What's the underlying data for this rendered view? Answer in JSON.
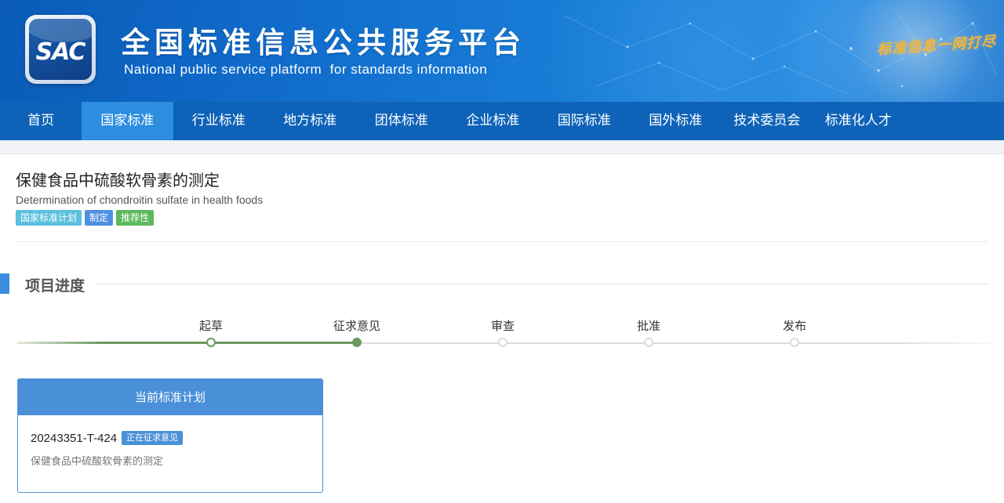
{
  "header": {
    "logo_text": "SAC",
    "title": "全国标准信息公共服务平台",
    "subtitle": "National public service platform  for standards information",
    "slogan": "标准信息一网打尽"
  },
  "nav": {
    "items": [
      {
        "label": "首页",
        "active": false
      },
      {
        "label": "国家标准",
        "active": true
      },
      {
        "label": "行业标准",
        "active": false
      },
      {
        "label": "地方标准",
        "active": false
      },
      {
        "label": "团体标准",
        "active": false
      },
      {
        "label": "企业标准",
        "active": false
      },
      {
        "label": "国际标准",
        "active": false
      },
      {
        "label": "国外标准",
        "active": false
      },
      {
        "label": "技术委员会",
        "active": false
      },
      {
        "label": "标准化人才",
        "active": false
      }
    ]
  },
  "standard": {
    "title_cn": "保健食品中硫酸软骨素的测定",
    "title_en": "Determination of chondroitin sulfate in health foods",
    "tags": [
      "国家标准计划",
      "制定",
      "推荐性"
    ]
  },
  "progress": {
    "heading": "项目进度",
    "steps": [
      {
        "label": "起草",
        "state": "done"
      },
      {
        "label": "征求意见",
        "state": "current"
      },
      {
        "label": "审查",
        "state": "pending"
      },
      {
        "label": "批准",
        "state": "pending"
      },
      {
        "label": "发布",
        "state": "pending"
      }
    ]
  },
  "current_plan": {
    "header": "当前标准计划",
    "plan_number": "20243351-T-424",
    "status": "正在征求意见",
    "name": "保健食品中硫酸软骨素的测定"
  },
  "colors": {
    "nav_bg": "#0e63b8",
    "nav_active": "#2d8ee0",
    "progress_done": "#6d9a5f",
    "card_accent": "#4a90d9"
  }
}
